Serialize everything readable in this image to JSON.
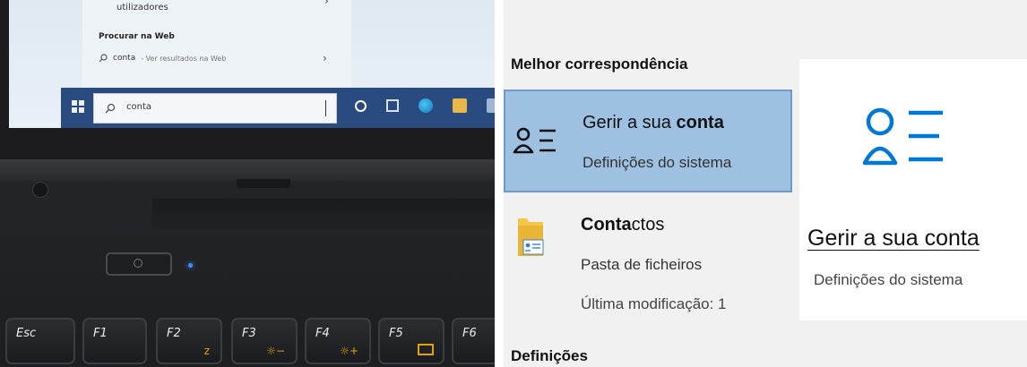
{
  "photo": {
    "search_panel": {
      "partial_item": "utilizadores",
      "web_heading": "Procurar na Web",
      "web_query": "conta",
      "web_suffix": "- Ver resultados na Web"
    },
    "taskbar": {
      "search_text": "conta"
    },
    "keys": [
      {
        "label": "Esc"
      },
      {
        "label": "F1"
      },
      {
        "label": "F2",
        "symbol": "z"
      },
      {
        "label": "F3",
        "symbol": "☼−"
      },
      {
        "label": "F4",
        "symbol": "☼+"
      },
      {
        "label": "F5"
      },
      {
        "label": "F6"
      }
    ]
  },
  "results": {
    "best_match_heading": "Melhor correspondência",
    "items": [
      {
        "title_pre": "Gerir a sua ",
        "title_bold": "conta",
        "subtitle": "Definições do sistema",
        "icon": "account-list-icon",
        "selected": true
      },
      {
        "title_bold": "Conta",
        "title_post": "ctos",
        "subtitle": "Pasta de ficheiros",
        "meta": "Última modificação: 1",
        "icon": "folder-contact-icon",
        "selected": false
      }
    ],
    "settings_heading": "Definições",
    "detail": {
      "title": "Gerir a sua conta",
      "subtitle": "Definições do sistema",
      "icon": "account-list-icon"
    }
  },
  "colors": {
    "accent_blue": "#0078d4",
    "selected_bg": "#9ec0e1",
    "taskbar": "#2a4b80"
  }
}
